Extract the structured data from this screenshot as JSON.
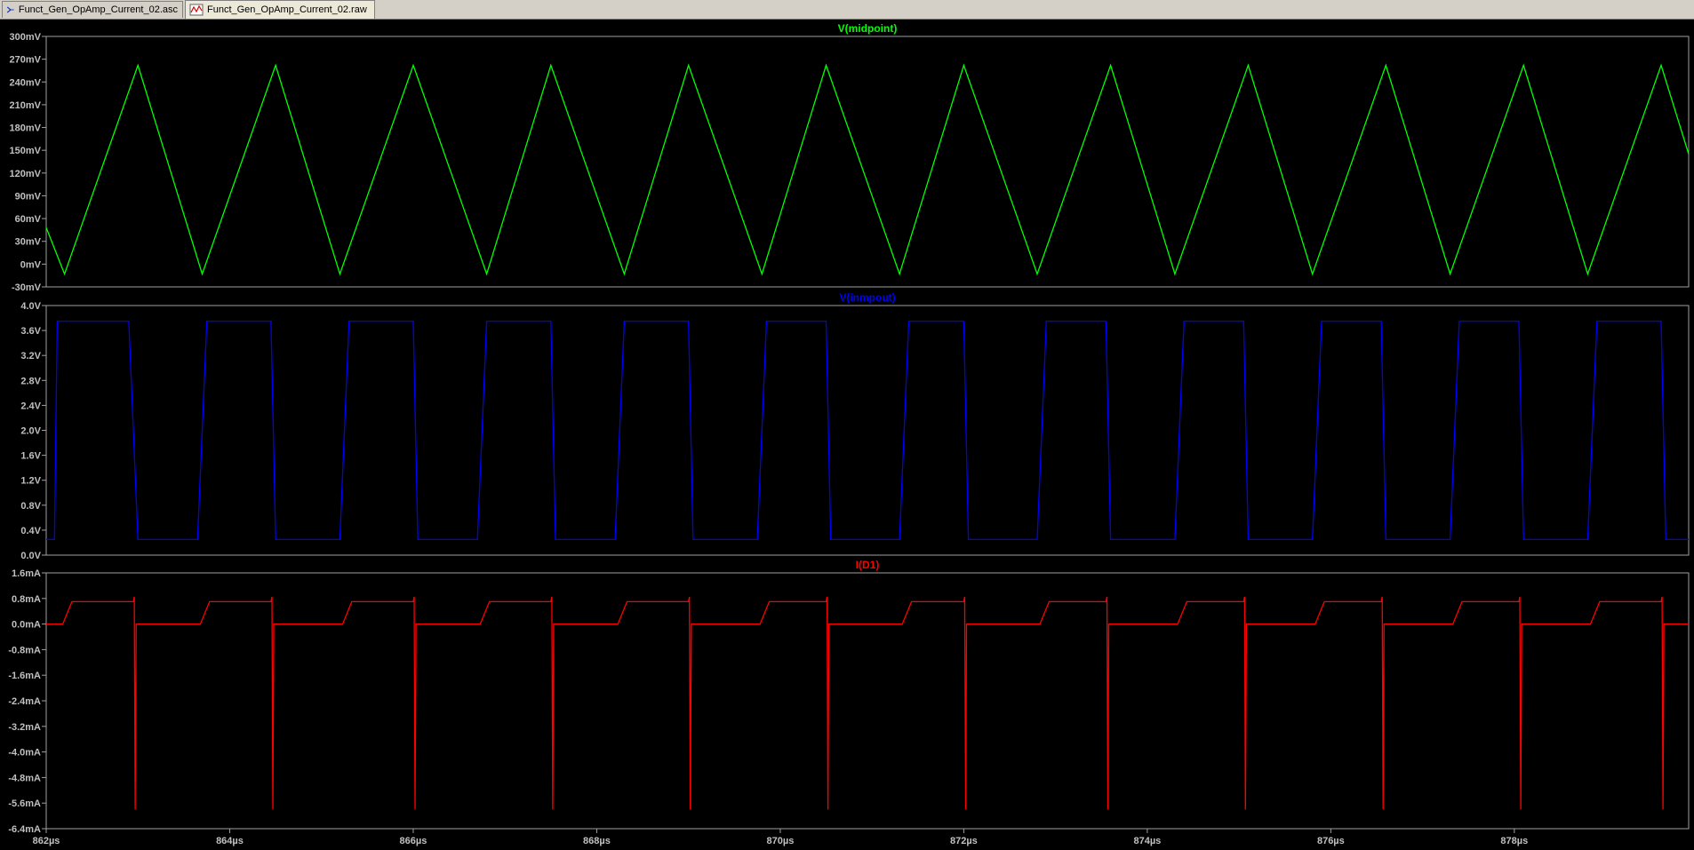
{
  "tabs": [
    {
      "label": "Funct_Gen_OpAmp_Current_02.asc",
      "icon": "schematic-icon",
      "active": false
    },
    {
      "label": "Funct_Gen_OpAmp_Current_02.raw",
      "icon": "waveform-icon",
      "active": true
    }
  ],
  "colors": {
    "background": "#000000",
    "frame": "#a0a0a0",
    "axis_text": "#c0c0c0",
    "v_midpoint": "#00ff00",
    "v_inmpout": "#0000ff",
    "i_d1": "#ff0000"
  },
  "x_axis": {
    "range": [
      862,
      879.9
    ],
    "unit": "µs",
    "ticks": [
      862,
      864,
      866,
      868,
      870,
      872,
      874,
      876,
      878
    ],
    "tick_labels": [
      "862µs",
      "864µs",
      "866µs",
      "868µs",
      "870µs",
      "872µs",
      "874µs",
      "876µs",
      "878µs"
    ]
  },
  "chart_data": [
    {
      "type": "line",
      "title": "V(midpoint)",
      "color": "#00ff00",
      "ylim": [
        -30,
        300
      ],
      "y_unit": "mV",
      "yticks": [
        300,
        270,
        240,
        210,
        180,
        150,
        120,
        90,
        60,
        30,
        0,
        -30
      ],
      "ytick_labels": [
        "300mV",
        "270mV",
        "240mV",
        "210mV",
        "180mV",
        "150mV",
        "120mV",
        "90mV",
        "60mV",
        "30mV",
        "0mV",
        "-30mV"
      ],
      "grid": false,
      "series": [
        {
          "x": [
            862.0,
            862.2,
            863.0,
            863.7,
            864.5,
            865.2,
            866.0,
            866.8,
            867.5,
            868.3,
            869.0,
            869.8,
            870.5,
            871.3,
            872.0,
            872.8,
            873.6,
            874.3,
            875.1,
            875.8,
            876.6,
            877.3,
            878.1,
            878.8,
            879.6,
            879.9
          ],
          "y": [
            48,
            -13,
            262,
            -13,
            262,
            -13,
            262,
            -13,
            262,
            -13,
            262,
            -13,
            262,
            -13,
            262,
            -13,
            262,
            -13,
            262,
            -13,
            262,
            -13,
            262,
            -13,
            262,
            145
          ]
        }
      ]
    },
    {
      "type": "line",
      "title": "V(inmpout)",
      "color": "#0000ff",
      "ylim": [
        0.0,
        4.0
      ],
      "y_unit": "V",
      "yticks": [
        4.0,
        3.6,
        3.2,
        2.8,
        2.4,
        2.0,
        1.6,
        1.2,
        0.8,
        0.4,
        0.0
      ],
      "ytick_labels": [
        "4.0V",
        "3.6V",
        "3.2V",
        "2.8V",
        "2.4V",
        "2.0V",
        "1.6V",
        "1.2V",
        "0.8V",
        "0.4V",
        "0.0V"
      ],
      "grid": false,
      "series": [
        {
          "x": [
            862.0,
            862.09,
            862.12,
            862.9,
            863.0,
            863.65,
            863.75,
            864.45,
            864.5,
            865.2,
            865.3,
            866.0,
            866.05,
            866.7,
            866.8,
            867.5,
            867.55,
            868.2,
            868.3,
            869.0,
            869.05,
            869.75,
            869.85,
            870.5,
            870.55,
            871.3,
            871.4,
            872.0,
            872.05,
            872.8,
            872.9,
            873.55,
            873.6,
            874.3,
            874.4,
            875.05,
            875.1,
            875.8,
            875.9,
            876.55,
            876.6,
            877.3,
            877.4,
            878.05,
            878.1,
            878.8,
            878.9,
            879.6,
            879.65,
            879.9
          ],
          "y": [
            0.25,
            0.25,
            3.75,
            3.75,
            0.25,
            0.25,
            3.75,
            3.75,
            0.25,
            0.25,
            3.75,
            3.75,
            0.25,
            0.25,
            3.75,
            3.75,
            0.25,
            0.25,
            3.75,
            3.75,
            0.25,
            0.25,
            3.75,
            3.75,
            0.25,
            0.25,
            3.75,
            3.75,
            0.25,
            0.25,
            3.75,
            3.75,
            0.25,
            0.25,
            3.75,
            3.75,
            0.25,
            0.25,
            3.75,
            3.75,
            0.25,
            0.25,
            3.75,
            3.75,
            0.25,
            0.25,
            3.75,
            3.75,
            0.25,
            0.25
          ]
        }
      ]
    },
    {
      "type": "line",
      "title": "I(D1)",
      "color": "#ff0000",
      "ylim": [
        -6.4,
        1.6
      ],
      "y_unit": "mA",
      "yticks": [
        1.6,
        0.8,
        0.0,
        -0.8,
        -1.6,
        -2.4,
        -3.2,
        -4.0,
        -4.8,
        -5.6,
        -6.4
      ],
      "ytick_labels": [
        "1.6mA",
        "0.8mA",
        "0.0mA",
        "-0.8mA",
        "-1.6mA",
        "-2.4mA",
        "-3.2mA",
        "-4.0mA",
        "-4.8mA",
        "-5.6mA",
        "-6.4mA"
      ],
      "grid": false,
      "series": [
        {
          "x": [
            862.0,
            862.18,
            862.28,
            862.95,
            862.96,
            862.97,
            862.98,
            863.0,
            863.68,
            863.78,
            864.45,
            864.46,
            864.47,
            864.48,
            864.5,
            865.23,
            865.33,
            866.0,
            866.01,
            866.02,
            866.03,
            866.05,
            866.73,
            866.83,
            867.5,
            867.51,
            867.52,
            867.53,
            867.55,
            868.23,
            868.33,
            869.0,
            869.01,
            869.02,
            869.03,
            869.05,
            869.78,
            869.88,
            870.5,
            870.51,
            870.52,
            870.53,
            870.55,
            871.33,
            871.43,
            872.0,
            872.01,
            872.02,
            872.03,
            872.05,
            872.83,
            872.93,
            873.55,
            873.56,
            873.57,
            873.58,
            873.6,
            874.33,
            874.43,
            875.05,
            875.06,
            875.07,
            875.08,
            875.1,
            875.83,
            875.93,
            876.55,
            876.56,
            876.57,
            876.58,
            876.6,
            877.33,
            877.43,
            878.05,
            878.06,
            878.07,
            878.08,
            878.1,
            878.83,
            878.93,
            879.6,
            879.61,
            879.62,
            879.63,
            879.65,
            879.9
          ],
          "y": [
            0.0,
            0.0,
            0.7,
            0.7,
            0.85,
            -5.8,
            0.0,
            0.0,
            0.0,
            0.7,
            0.7,
            0.85,
            -5.8,
            0.0,
            0.0,
            0.0,
            0.7,
            0.7,
            0.85,
            -5.8,
            0.0,
            0.0,
            0.0,
            0.7,
            0.7,
            0.85,
            -5.8,
            0.0,
            0.0,
            0.0,
            0.7,
            0.7,
            0.85,
            -5.8,
            0.0,
            0.0,
            0.0,
            0.7,
            0.7,
            0.85,
            -5.8,
            0.0,
            0.0,
            0.0,
            0.7,
            0.7,
            0.85,
            -5.8,
            0.0,
            0.0,
            0.0,
            0.7,
            0.7,
            0.85,
            -5.8,
            0.0,
            0.0,
            0.0,
            0.7,
            0.7,
            0.85,
            -5.8,
            0.0,
            0.0,
            0.0,
            0.7,
            0.7,
            0.85,
            -5.8,
            0.0,
            0.0,
            0.0,
            0.7,
            0.7,
            0.85,
            -5.8,
            0.0,
            0.0,
            0.0,
            0.7,
            0.7,
            0.85,
            -5.8,
            0.0,
            0.0,
            0.0
          ]
        }
      ]
    }
  ]
}
